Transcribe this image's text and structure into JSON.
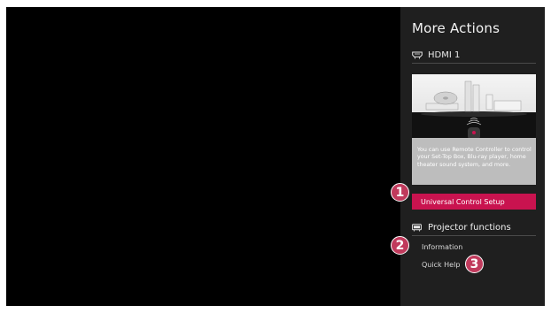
{
  "panel": {
    "title": "More Actions",
    "input_source": {
      "icon": "hdmi-icon",
      "label": "HDMI 1"
    },
    "promo": {
      "image": "universal-control-devices-illustration",
      "text": "You can use Remote Controller to control your Set-Top Box, Blu-ray player, home theater sound system, and more."
    },
    "setup_button_label": "Universal Control Setup",
    "projector_section": {
      "icon": "projector-icon",
      "title": "Projector functions",
      "items": [
        "Information",
        "Quick Help"
      ]
    }
  },
  "callouts": [
    "1",
    "2",
    "3"
  ],
  "colors": {
    "accent": "#c9134f",
    "panel_bg": "#1f1f1f",
    "screen_bg": "#000000",
    "callout": "#c03a5c",
    "promo_box": "#bdbdbd"
  }
}
